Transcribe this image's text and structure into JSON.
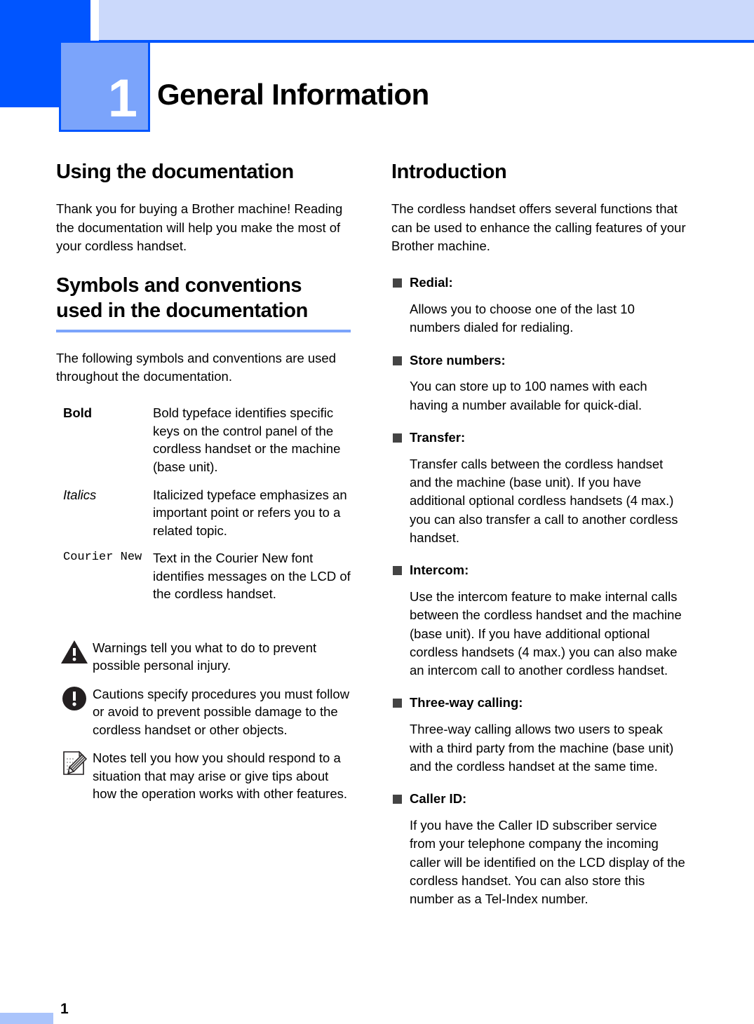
{
  "chapter": {
    "number": "1",
    "title": "General Information"
  },
  "left_column": {
    "heading_using": "Using the documentation",
    "intro_paragraph": "Thank you for buying a Brother machine! Reading the documentation will help you make the most of your cordless handset.",
    "heading_symbols": "Symbols and conventions used in the documentation",
    "symbols_intro": "The following symbols and conventions are used throughout the documentation.",
    "conventions_table": [
      {
        "term": "Bold",
        "style": "bold",
        "description": "Bold typeface identifies specific keys on the control panel of the cordless handset or the machine (base unit)."
      },
      {
        "term": "Italics",
        "style": "italic",
        "description": "Italicized typeface emphasizes an important point or refers you to a related topic."
      },
      {
        "term": "Courier New",
        "style": "courier",
        "description": "Text in the Courier New font identifies messages on the LCD of the cordless handset."
      }
    ],
    "notices": [
      {
        "icon": "warning-triangle-icon",
        "text": "Warnings tell you what to do to prevent possible personal injury."
      },
      {
        "icon": "caution-circle-icon",
        "text": "Cautions specify procedures you must follow or avoid to prevent possible damage to the cordless handset or other objects."
      },
      {
        "icon": "note-pencil-icon",
        "text": "Notes tell you how you should respond to a situation that may arise or give tips about how the operation works with other features."
      }
    ]
  },
  "right_column": {
    "heading_introduction": "Introduction",
    "intro_paragraph": "The cordless handset offers several functions that can be used to enhance the calling features of your Brother machine.",
    "features": [
      {
        "label": "Redial:",
        "description": "Allows you to choose one of the last 10 numbers dialed for redialing."
      },
      {
        "label": "Store numbers:",
        "description": "You can store up to 100 names with each having a number available for quick-dial."
      },
      {
        "label": "Transfer:",
        "description": "Transfer calls between the cordless handset and the machine (base unit). If you have additional optional cordless handsets (4 max.) you can also transfer a call to another cordless handset."
      },
      {
        "label": "Intercom:",
        "description": "Use the intercom feature to make internal calls between the cordless handset and the machine (base unit). If you have additional optional cordless handsets (4 max.) you can also make an intercom call to another cordless handset."
      },
      {
        "label": "Three-way calling:",
        "description": "Three-way calling allows two users to speak with a third party from the machine (base unit) and the cordless handset at the same time."
      },
      {
        "label": "Caller ID:",
        "description": "If you have the Caller ID subscriber service from your telephone company the incoming caller will be identified on the LCD display of the cordless handset. You can also store this number as a Tel-Index number."
      }
    ]
  },
  "footer": {
    "page_number": "1"
  },
  "colors": {
    "header_band": "#cbd9fb",
    "header_rule": "#0055ff",
    "chapter_block": "#0055ff",
    "chapter_box_fill": "#7ba4fb",
    "heading_underline": "#7ba4fb",
    "bullet_square": "#444444",
    "footer_bar": "#aac4fb"
  }
}
